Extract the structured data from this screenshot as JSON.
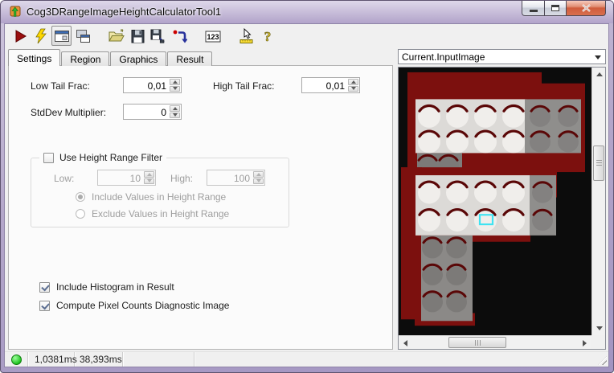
{
  "window": {
    "title": "Cog3DRangeImageHeightCalculatorTool1"
  },
  "toolbar": {
    "items": [
      "run-icon",
      "lightning-icon",
      "show-display-icon",
      "float-display-icon",
      "open-icon",
      "save-icon",
      "save-as-icon",
      "reset-icon",
      "calculator-icon",
      "probe-icon",
      "help-icon"
    ],
    "calc_label": "123",
    "help_label": "?"
  },
  "tabs": [
    {
      "label": "Settings",
      "active": true
    },
    {
      "label": "Region",
      "active": false
    },
    {
      "label": "Graphics",
      "active": false
    },
    {
      "label": "Result",
      "active": false
    }
  ],
  "settings": {
    "low_tail": {
      "label": "Low Tail Frac:",
      "value": "0,01"
    },
    "high_tail": {
      "label": "High Tail Frac:",
      "value": "0,01"
    },
    "stddev": {
      "label": "StdDev Multiplier:",
      "value": "0"
    },
    "height_filter": {
      "label": "Use Height Range Filter",
      "checked": false,
      "low": {
        "label": "Low:",
        "value": "10"
      },
      "high": {
        "label": "High:",
        "value": "100"
      },
      "include": {
        "label": "Include Values in Height Range",
        "selected": true
      },
      "exclude": {
        "label": "Exclude Values in Height Range",
        "selected": false
      }
    },
    "include_histogram": {
      "label": "Include Histogram in Result",
      "checked": true
    },
    "compute_pixel_counts": {
      "label": "Compute Pixel Counts Diagnostic Image",
      "checked": true
    }
  },
  "image_panel": {
    "selected_image": "Current.InputImage"
  },
  "statusbar": {
    "time1": "1,0381ms",
    "time2": "38,393ms"
  },
  "colors": {
    "frame_purple": "#b4a7ca",
    "close_red": "#d96f4e",
    "range_red": "#7c100e",
    "crescent_red": "#5a0707",
    "tray_light": "#dcdad7",
    "circle_white": "#f0eeeb",
    "plate_gray": "#8f8e8c",
    "circle_gray": "#838180",
    "selection_cyan": "#3fe3f2",
    "status_green": "#21c421"
  }
}
